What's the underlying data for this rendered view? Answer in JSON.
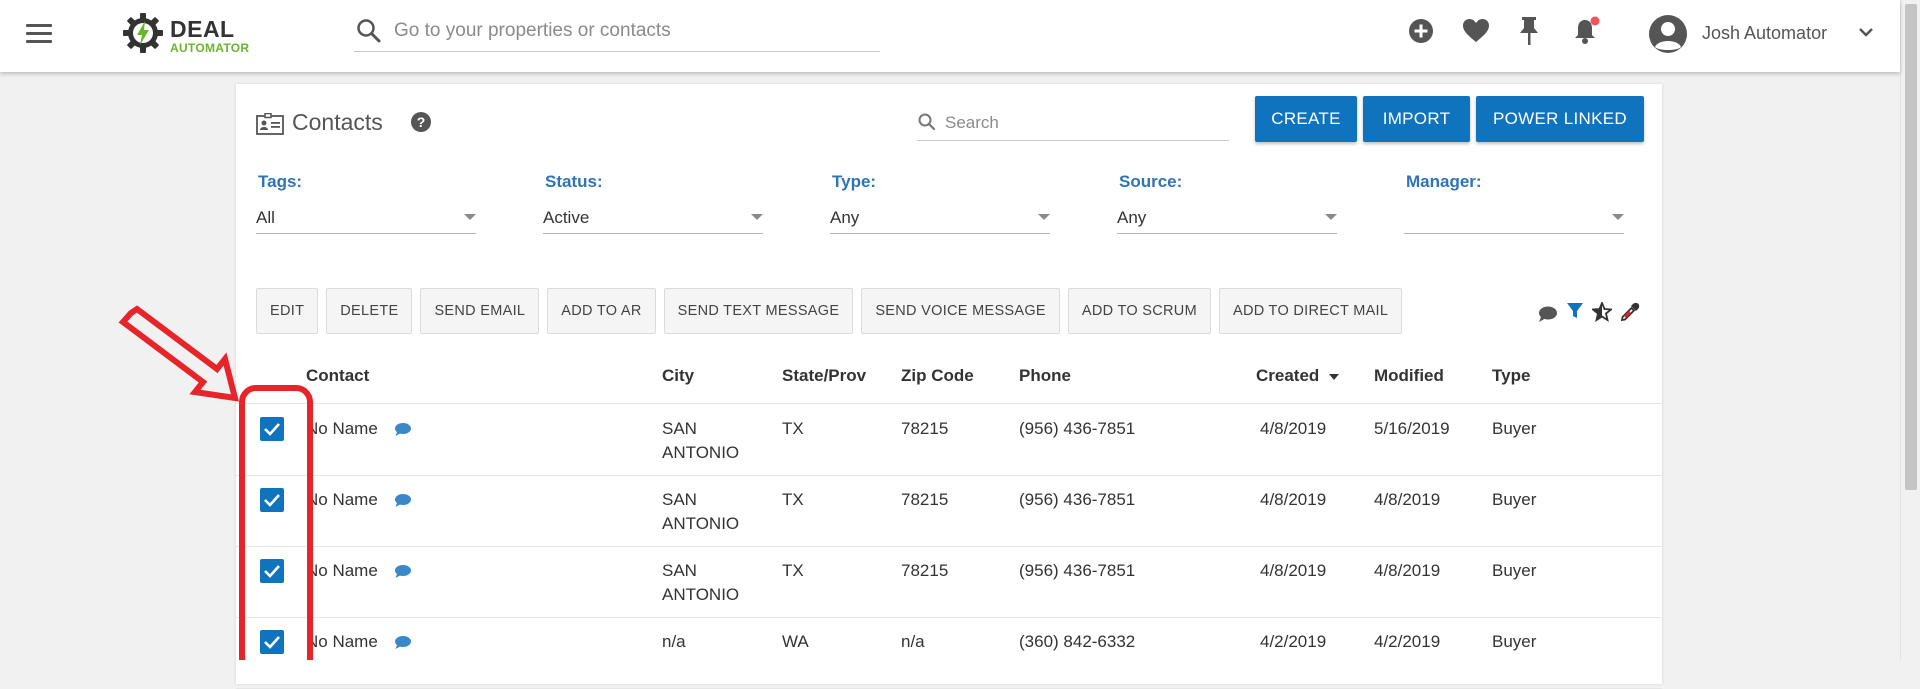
{
  "header": {
    "logo_top": "DEAL",
    "logo_bottom": "AUTOMATOR",
    "search_placeholder": "Go to your properties or contacts",
    "user_name": "Josh Automator"
  },
  "icons": {
    "menu": "hamburger-icon",
    "search": "search-icon",
    "add": "plus-circle-icon",
    "favorites": "heart-icon",
    "pinned": "pin-icon",
    "notifications": "bell-icon",
    "avatar": "user-avatar-icon",
    "chevron": "chevron-down-icon"
  },
  "colors": {
    "primary": "#0f74bd",
    "label_blue": "#2f74b5",
    "logo_green": "#6bb52e",
    "annotation_red": "#e8242b",
    "notification_dot": "#f2545b"
  },
  "page": {
    "title": "Contacts",
    "search_placeholder": "Search",
    "buttons": {
      "create": "CREATE",
      "import": "IMPORT",
      "power_linked": "POWER LINKED"
    }
  },
  "filters": [
    {
      "label": "Tags:",
      "value": "All"
    },
    {
      "label": "Status:",
      "value": "Active"
    },
    {
      "label": "Type:",
      "value": "Any"
    },
    {
      "label": "Source:",
      "value": "Any"
    },
    {
      "label": "Manager:",
      "value": ""
    }
  ],
  "actions": [
    "EDIT",
    "DELETE",
    "SEND EMAIL",
    "ADD TO AR",
    "SEND TEXT MESSAGE",
    "SEND VOICE MESSAGE",
    "ADD TO SCRUM",
    "ADD TO DIRECT MAIL"
  ],
  "table": {
    "columns": [
      "Contact",
      "City",
      "State/Prov",
      "Zip Code",
      "Phone",
      "Created",
      "Modified",
      "Type"
    ],
    "sorted_column": "Created",
    "rows": [
      {
        "contact": "No Name",
        "city": "SAN ANTONIO",
        "state": "TX",
        "zip": "78215",
        "phone": "(956) 436-7851",
        "created": "4/8/2019",
        "modified": "5/16/2019",
        "type": "Buyer",
        "checked": true
      },
      {
        "contact": "No Name",
        "city": "SAN ANTONIO",
        "state": "TX",
        "zip": "78215",
        "phone": "(956) 436-7851",
        "created": "4/8/2019",
        "modified": "4/8/2019",
        "type": "Buyer",
        "checked": true
      },
      {
        "contact": "No Name",
        "city": "SAN ANTONIO",
        "state": "TX",
        "zip": "78215",
        "phone": "(956) 436-7851",
        "created": "4/8/2019",
        "modified": "4/8/2019",
        "type": "Buyer",
        "checked": true
      },
      {
        "contact": "No Name",
        "city": "n/a",
        "state": "WA",
        "zip": "n/a",
        "phone": "(360) 842-6332",
        "created": "4/2/2019",
        "modified": "4/2/2019",
        "type": "Buyer",
        "checked": true
      }
    ]
  }
}
